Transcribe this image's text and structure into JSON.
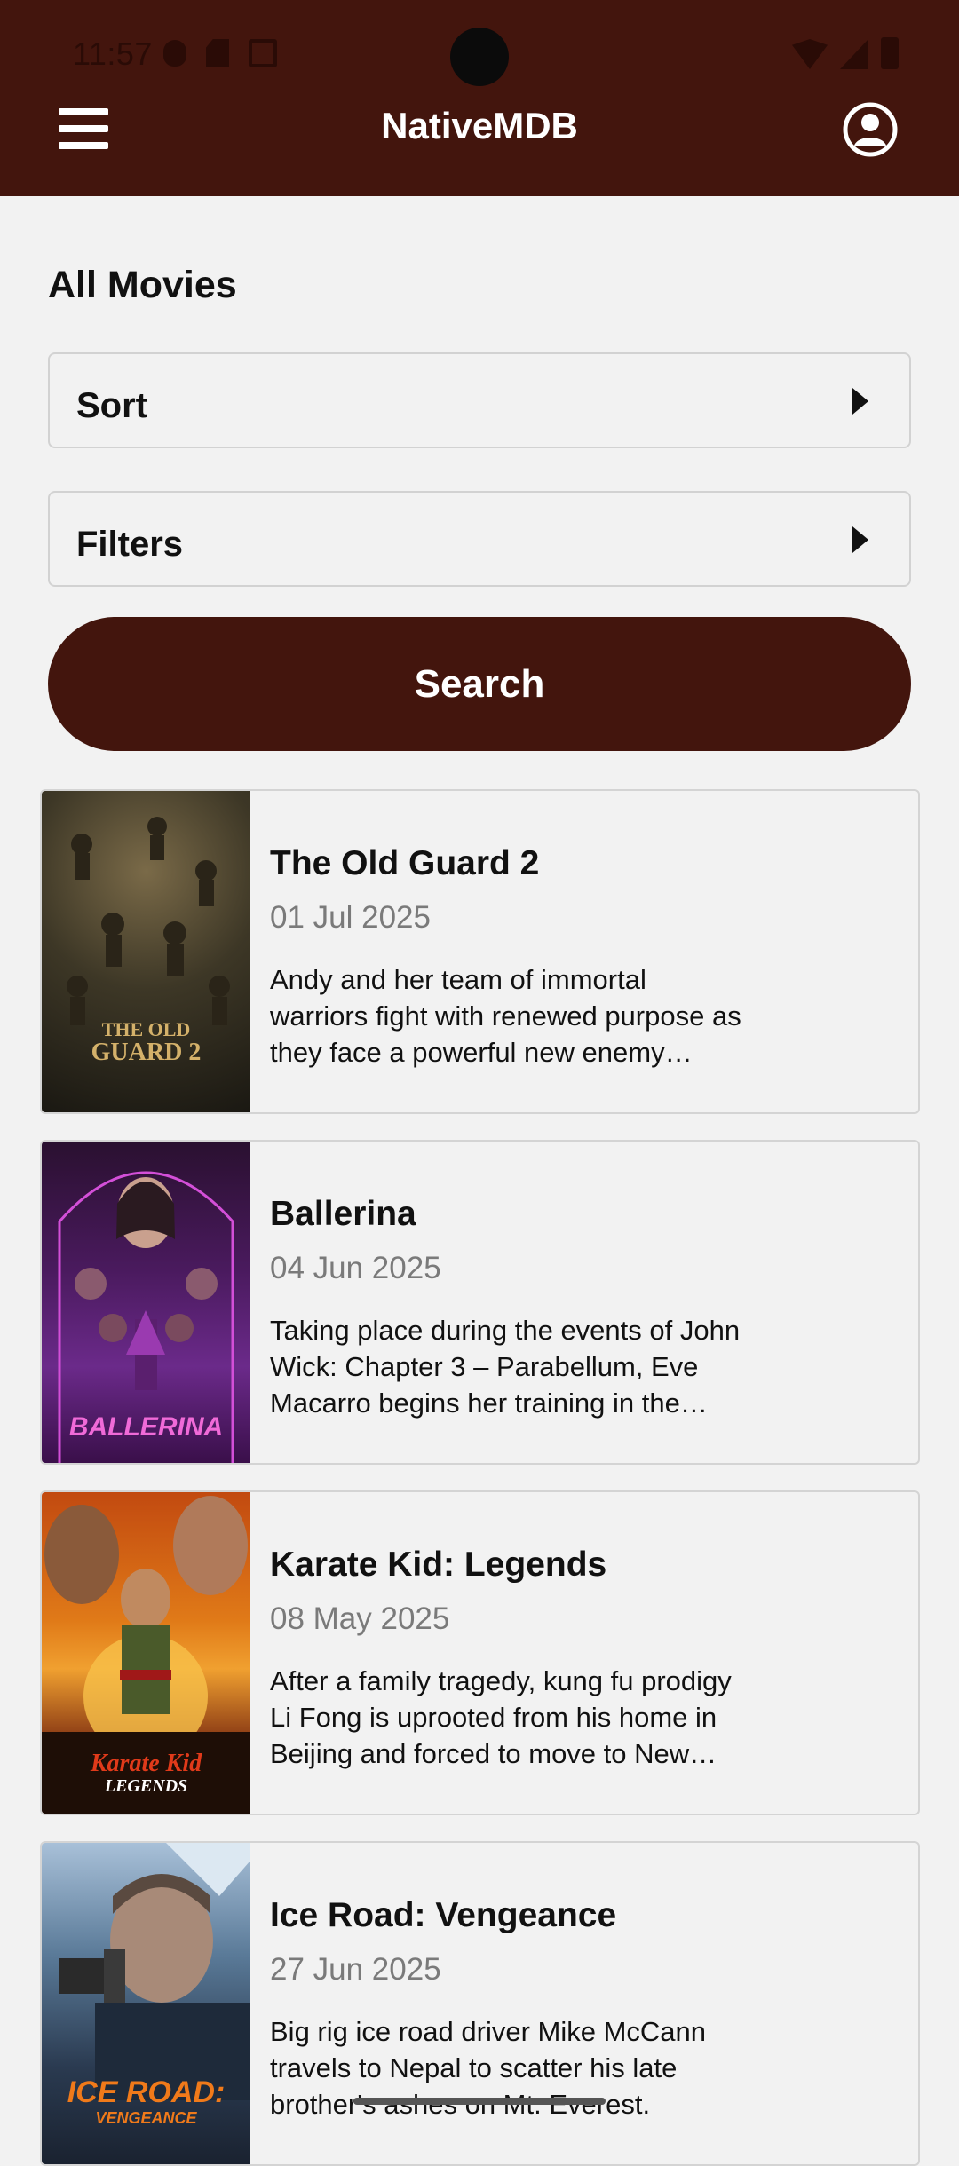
{
  "status_bar": {
    "time": "11:57"
  },
  "header": {
    "title": "NativeMDB",
    "menu_icon": "hamburger-menu-icon",
    "profile_icon": "account-circle-icon",
    "background": "#43150d"
  },
  "page": {
    "title": "All Movies"
  },
  "sort": {
    "label": "Sort"
  },
  "filters": {
    "label": "Filters"
  },
  "search": {
    "label": "Search"
  },
  "movies": [
    {
      "title": "The Old Guard 2",
      "date": "01 Jul 2025",
      "overview": "Andy and her team of immortal warriors fight with renewed purpose as they face a powerful new enemy threatening their mission to protect humanity.",
      "poster_text": [
        "THE OLD",
        "GUARD 2"
      ]
    },
    {
      "title": "Ballerina",
      "date": "04 Jun 2025",
      "overview": "Taking place during the events of John Wick: Chapter 3 – Parabellum, Eve Macarro begins her training in the assassin traditions of the Ruska Roma.",
      "poster_text": [
        "BALLERINA"
      ]
    },
    {
      "title": "Karate Kid: Legends",
      "date": "08 May 2025",
      "overview": "After a family tragedy, kung fu prodigy Li Fong is uprooted from his home in Beijing and forced to move to New York City with his mother.",
      "poster_text": [
        "Karate Kid",
        "LEGENDS"
      ]
    },
    {
      "title": "Ice Road: Vengeance",
      "date": "27 Jun 2025",
      "overview": "Big rig ice road driver Mike McCann travels to Nepal to scatter his late brother's ashes on Mt. Everest.",
      "poster_text": [
        "ICE ROAD:",
        "VENGEANCE"
      ]
    }
  ]
}
